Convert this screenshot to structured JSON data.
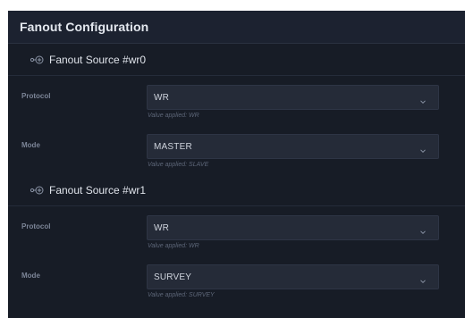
{
  "panel": {
    "title": "Fanout Configuration"
  },
  "sources": [
    {
      "title": "Fanout Source #wr0",
      "icon": "link-plus-icon",
      "fields": [
        {
          "label": "Protocol",
          "value": "WR",
          "applied": "Value applied: WR"
        },
        {
          "label": "Mode",
          "value": "MASTER",
          "applied": "Value applied: SLAVE"
        }
      ]
    },
    {
      "title": "Fanout Source #wr1",
      "icon": "link-plus-icon",
      "fields": [
        {
          "label": "Protocol",
          "value": "WR",
          "applied": "Value applied: WR"
        },
        {
          "label": "Mode",
          "value": "SURVEY",
          "applied": "Value applied: SURVEY"
        }
      ]
    }
  ],
  "colors": {
    "panel_bg": "#171c26",
    "select_bg": "#252b38",
    "label": "#7c8597",
    "helper": "#5d6678"
  }
}
